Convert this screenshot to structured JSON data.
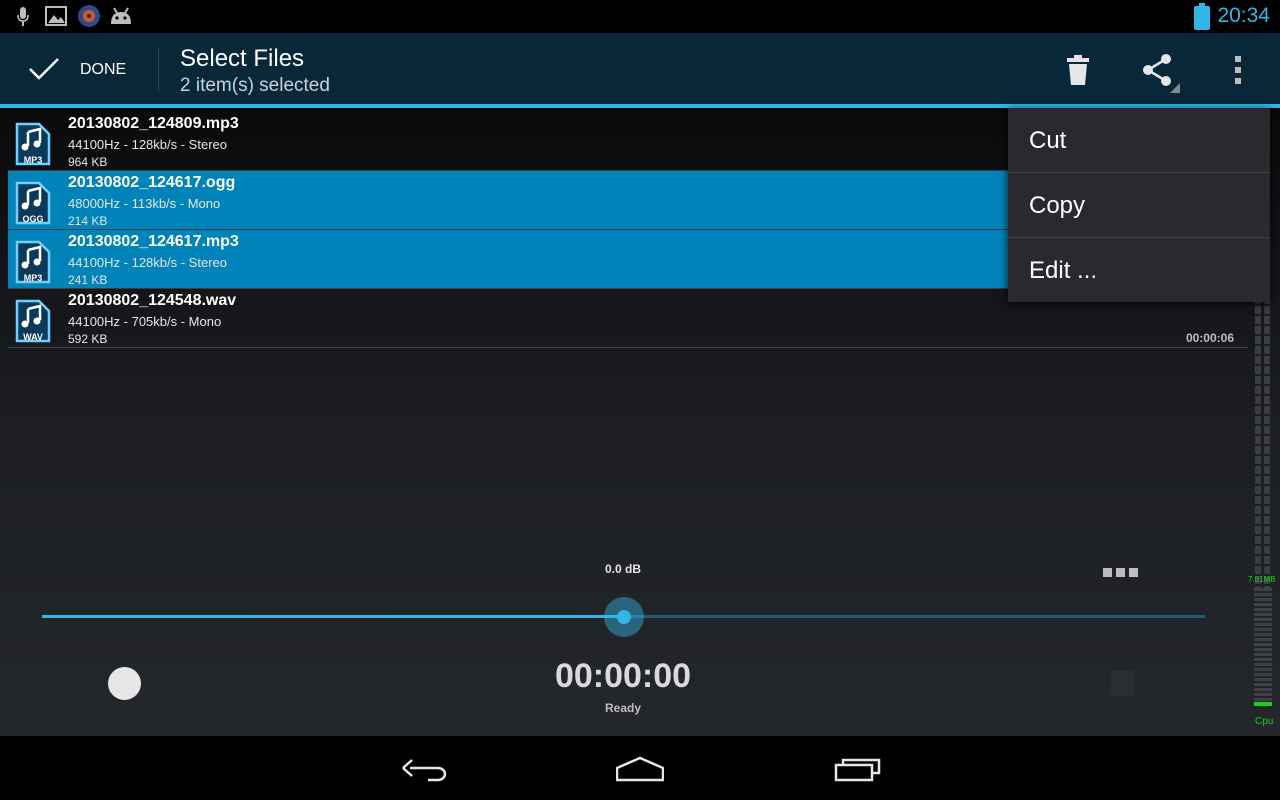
{
  "status_bar": {
    "time": "20:34",
    "icons": [
      "mic-icon",
      "image-icon",
      "app-icon",
      "android-icon",
      "battery-charging-icon"
    ]
  },
  "action_bar": {
    "done_label": "DONE",
    "title": "Select Files",
    "subtitle": "2 item(s) selected",
    "actions": [
      "trash-icon",
      "share-icon",
      "overflow-menu-icon"
    ]
  },
  "files": [
    {
      "name": "20130802_124809.mp3",
      "meta": "44100Hz - 128kb/s - Stereo",
      "size": "964 KB",
      "format": "MP3",
      "selected": false,
      "duration": ""
    },
    {
      "name": "20130802_124617.ogg",
      "meta": "48000Hz - 113kb/s - Mono",
      "size": "214 KB",
      "format": "OGG",
      "selected": true,
      "duration": ""
    },
    {
      "name": "20130802_124617.mp3",
      "meta": "44100Hz - 128kb/s - Stereo",
      "size": "241 KB",
      "format": "MP3",
      "selected": true,
      "duration": ""
    },
    {
      "name": "20130802_124548.wav",
      "meta": "44100Hz - 705kb/s - Mono",
      "size": "592 KB",
      "format": "WAV",
      "selected": false,
      "duration": "00:00:06"
    }
  ],
  "menu": {
    "items": [
      "Cut",
      "Copy",
      "Edit ..."
    ]
  },
  "player": {
    "gain": "0.0 dB",
    "time": "00:00:00",
    "state": "Ready",
    "slider_fraction": 0.5
  },
  "meters": {
    "memory": "7.81MB",
    "cpu_label": "Cpu"
  },
  "colors": {
    "accent": "#33b5e5",
    "selected_row": "#0083b8",
    "action_bar": "#08283a",
    "meter_green": "#19d219"
  }
}
